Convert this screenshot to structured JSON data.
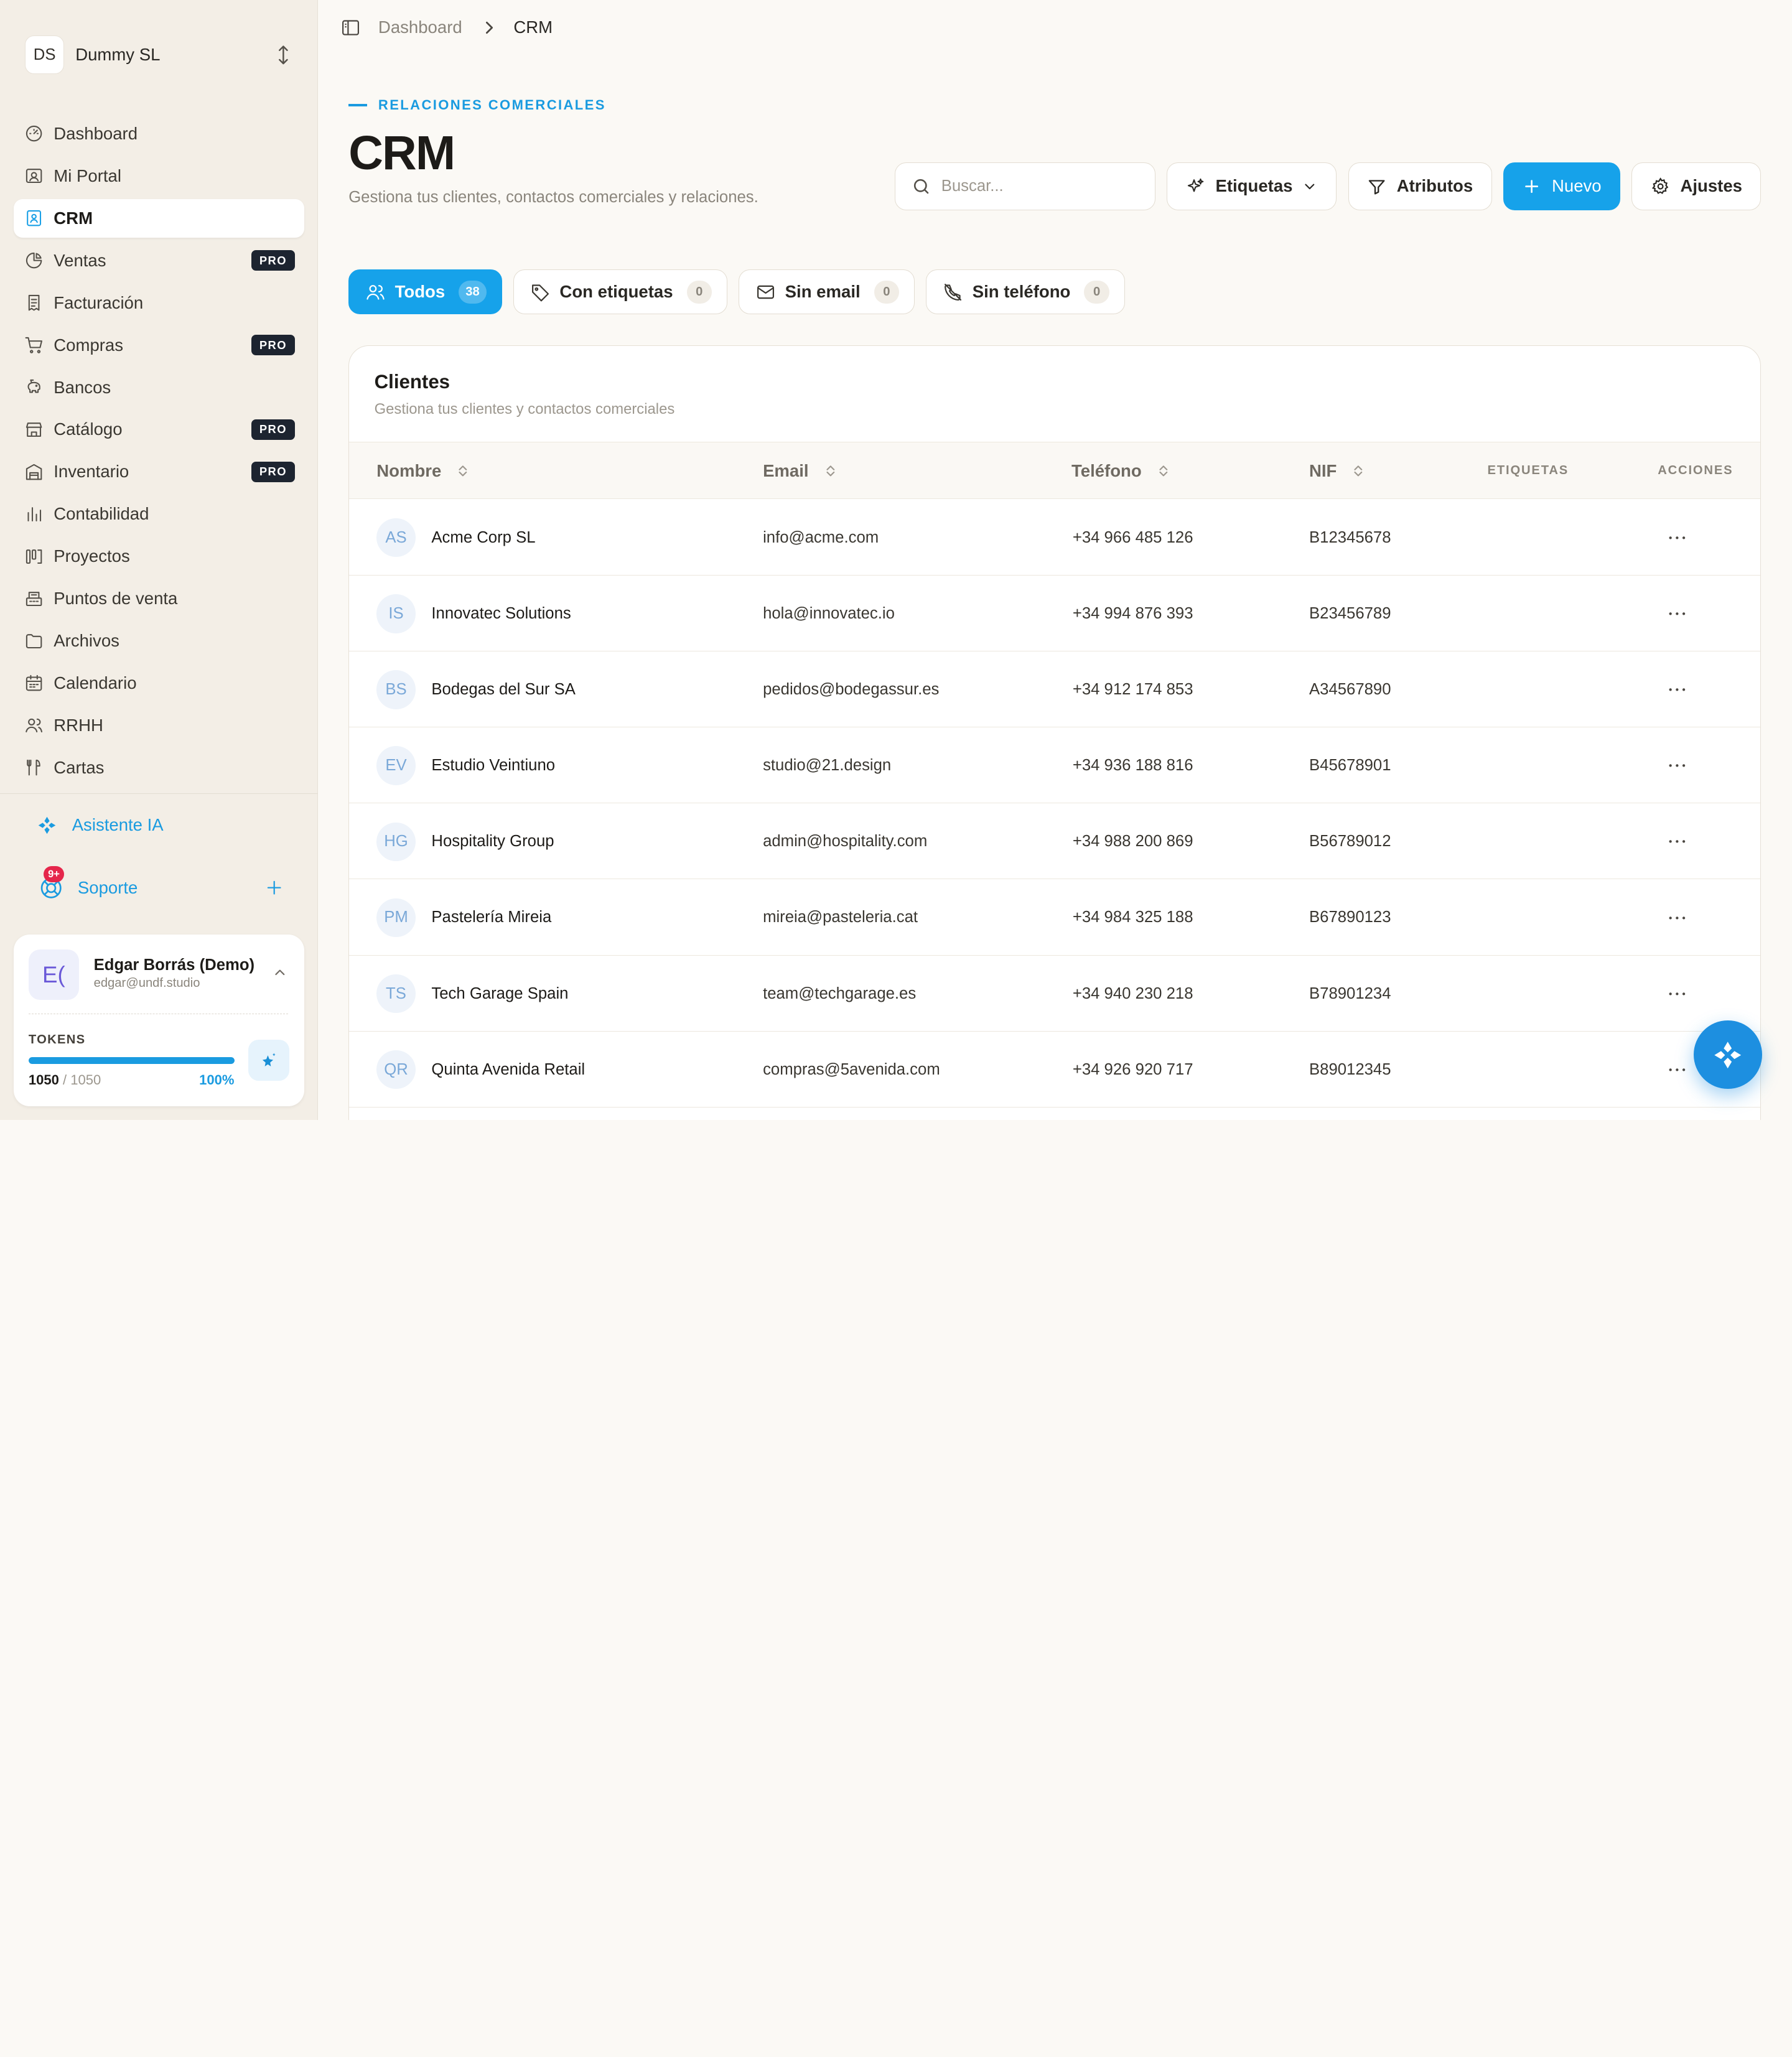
{
  "workspace": {
    "initials": "DS",
    "name": "Dummy SL"
  },
  "nav": [
    {
      "label": "Dashboard",
      "icon": "dashboard-icon",
      "pro": false,
      "active": false
    },
    {
      "label": "Mi Portal",
      "icon": "portal-icon",
      "pro": false,
      "active": false
    },
    {
      "label": "CRM",
      "icon": "contacts-icon",
      "pro": false,
      "active": true
    },
    {
      "label": "Ventas",
      "icon": "chart-pie-icon",
      "pro": true,
      "active": false
    },
    {
      "label": "Facturación",
      "icon": "invoice-icon",
      "pro": false,
      "active": false
    },
    {
      "label": "Compras",
      "icon": "cart-icon",
      "pro": true,
      "active": false
    },
    {
      "label": "Bancos",
      "icon": "piggy-bank-icon",
      "pro": false,
      "active": false
    },
    {
      "label": "Catálogo",
      "icon": "store-icon",
      "pro": true,
      "active": false
    },
    {
      "label": "Inventario",
      "icon": "warehouse-icon",
      "pro": true,
      "active": false
    },
    {
      "label": "Contabilidad",
      "icon": "bar-chart-icon",
      "pro": false,
      "active": false
    },
    {
      "label": "Proyectos",
      "icon": "kanban-icon",
      "pro": false,
      "active": false
    },
    {
      "label": "Puntos de venta",
      "icon": "register-icon",
      "pro": false,
      "active": false
    },
    {
      "label": "Archivos",
      "icon": "folder-icon",
      "pro": false,
      "active": false
    },
    {
      "label": "Calendario",
      "icon": "calendar-icon",
      "pro": false,
      "active": false
    },
    {
      "label": "RRHH",
      "icon": "users-icon",
      "pro": false,
      "active": false
    },
    {
      "label": "Cartas",
      "icon": "utensils-icon",
      "pro": false,
      "active": false
    }
  ],
  "pro_label": "PRO",
  "assistant": {
    "label": "Asistente IA"
  },
  "support": {
    "label": "Soporte",
    "badge": "9+"
  },
  "user": {
    "initials": "E(",
    "name": "Edgar Borrás (Demo)",
    "email": "edgar@undf.studio",
    "tokens_label": "TOKENS",
    "tokens_used": "1050",
    "tokens_total": "/ 1050",
    "tokens_pct": "100%",
    "tokens_fraction": 1.0
  },
  "breadcrumb": {
    "parent": "Dashboard",
    "current": "CRM"
  },
  "header": {
    "eyebrow": "RELACIONES COMERCIALES",
    "title": "CRM",
    "subtitle": "Gestiona tus clientes, contactos comerciales y relaciones."
  },
  "toolbar": {
    "search_placeholder": "Buscar...",
    "tags_label": "Etiquetas",
    "attributes_label": "Atributos",
    "new_label": "Nuevo",
    "settings_label": "Ajustes"
  },
  "filters": [
    {
      "label": "Todos",
      "count": "38",
      "icon": "users-icon",
      "active": true
    },
    {
      "label": "Con etiquetas",
      "count": "0",
      "icon": "tag-icon",
      "active": false
    },
    {
      "label": "Sin email",
      "count": "0",
      "icon": "mail-icon",
      "active": false
    },
    {
      "label": "Sin teléfono",
      "count": "0",
      "icon": "phone-off-icon",
      "active": false
    }
  ],
  "table": {
    "title": "Clientes",
    "subtitle": "Gestiona tus clientes y contactos comerciales",
    "columns": {
      "name": "Nombre",
      "email": "Email",
      "phone": "Teléfono",
      "nif": "NIF",
      "tags": "ETIQUETAS",
      "actions": "ACCIONES"
    },
    "rows": [
      {
        "initials": "AS",
        "name": "Acme Corp SL",
        "email": "info@acme.com",
        "phone": "+34 966 485 126",
        "nif": "B12345678"
      },
      {
        "initials": "IS",
        "name": "Innovatec Solutions",
        "email": "hola@innovatec.io",
        "phone": "+34 994 876 393",
        "nif": "B23456789"
      },
      {
        "initials": "BS",
        "name": "Bodegas del Sur SA",
        "email": "pedidos@bodegassur.es",
        "phone": "+34 912 174 853",
        "nif": "A34567890"
      },
      {
        "initials": "EV",
        "name": "Estudio Veintiuno",
        "email": "studio@21.design",
        "phone": "+34 936 188 816",
        "nif": "B45678901"
      },
      {
        "initials": "HG",
        "name": "Hospitality Group",
        "email": "admin@hospitality.com",
        "phone": "+34 988 200 869",
        "nif": "B56789012"
      },
      {
        "initials": "PM",
        "name": "Pastelería Mireia",
        "email": "mireia@pasteleria.cat",
        "phone": "+34 984 325 188",
        "nif": "B67890123"
      },
      {
        "initials": "TS",
        "name": "Tech Garage Spain",
        "email": "team@techgarage.es",
        "phone": "+34 940 230 218",
        "nif": "B78901234"
      },
      {
        "initials": "QR",
        "name": "Quinta Avenida Retail",
        "email": "compras@5avenida.com",
        "phone": "+34 926 920 717",
        "nif": "B89012345"
      }
    ]
  },
  "colors": {
    "accent": "#16a2ea",
    "pro_badge": "#1d2430",
    "notif": "#e5264b"
  }
}
